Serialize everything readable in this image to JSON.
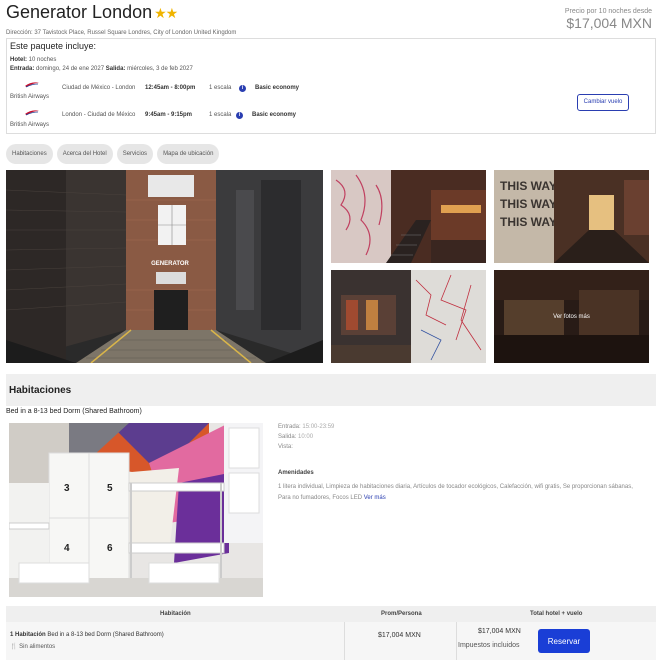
{
  "hotel": {
    "name": "Generator London",
    "stars": "★★",
    "address": "Dirección: 37 Tavistock Place, Russel Square Londres, City of London United Kingdom",
    "price_caption": "Precio por 10 noches desde",
    "price": "$17,004 MXN"
  },
  "package": {
    "title": "Este paquete incluye:",
    "hotel_label": "Hotel:",
    "hotel_value": "10 noches",
    "checkin_label": "Entrada:",
    "checkin_value": "domingo, 24 de ene 2027",
    "checkout_label": "Salida:",
    "checkout_value": "miércoles, 3 de feb 2027",
    "flights": [
      {
        "airline": "British Airways",
        "route": "Ciudad de México - London",
        "times": "12:45am  -  8:00pm",
        "stops": "1 escala",
        "cabin": "Basic economy"
      },
      {
        "airline": "British Airways",
        "route": "London - Ciudad de México",
        "times": "9:45am  -  9:15pm",
        "stops": "1 escala",
        "cabin": "Basic economy"
      }
    ],
    "change_flight_label": "Cambiar vuelo"
  },
  "tabs": [
    "Habitaciones",
    "Acerca del Hotel",
    "Servicios",
    "Mapa de ubicación"
  ],
  "gallery": {
    "main_sign": "GENERATOR",
    "thumb_text": "THIS WAY THIS WAY",
    "more_photos": "Ver fotos más"
  },
  "rooms": {
    "section_title": "Habitaciones",
    "room_name": "Bed in a 8-13 bed Dorm (Shared Bathroom)",
    "checkin_label": "Entrada:",
    "checkin_value": "15:00-23:59",
    "checkout_label": "Salida:",
    "checkout_value": "10:00",
    "view_label": "Vista:",
    "amenities_title": "Amenidades",
    "amenities_text": "1 litera individual, Limpieza de habitaciones diaria, Artículos de tocador ecológicos, Calefacción, wifi gratis, Se proporcionan sábanas, Para no fumadores, Focos LED",
    "see_more": "Ver más",
    "bed_numbers": [
      "3",
      "5",
      "4",
      "6"
    ]
  },
  "table": {
    "headers": [
      "Habitación",
      "Prom/Persona",
      "Total hotel + vuelo"
    ],
    "row": {
      "room_count": "1 Habitación",
      "room_name": "Bed in a 8-13 bed Dorm (Shared Bathroom)",
      "meal": "Sin alimentos",
      "avg_price": "$17,004 MXN",
      "total": "$17,004 MXN",
      "tax_note": "Impuestos incluidos",
      "reserve_label": "Reservar"
    }
  },
  "colors": {
    "accent": "#1a3ed6",
    "star": "#f0b400"
  }
}
